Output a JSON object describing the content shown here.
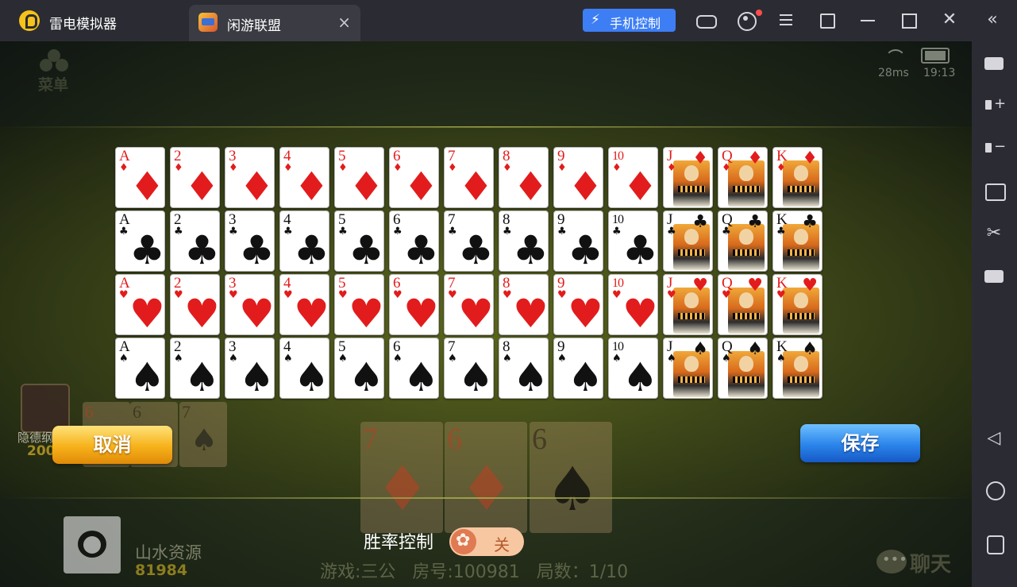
{
  "titlebar": {
    "app_name": "雷电模拟器",
    "tab_title": "闲游联盟",
    "tab_close": "×",
    "phone_control": "手机控制"
  },
  "game": {
    "menu_label": "菜单",
    "ping": "28ms",
    "clock": "19:13",
    "cancel_label": "取消",
    "save_label": "保存",
    "win_rate_label": "胜率控制",
    "win_rate_state": "关",
    "left_player": {
      "name": "隐德纲",
      "score": "200"
    },
    "self": {
      "name": "山水资源",
      "score": "81984"
    },
    "game_info": "游戏:三公   房号:100981   局数：1/10",
    "chat_label": "聊天"
  },
  "background_cards": {
    "left_hand": [
      "6",
      "6",
      "7"
    ],
    "center_hand": [
      "7",
      "6",
      "6"
    ]
  },
  "card_grid": {
    "ranks": [
      "A",
      "2",
      "3",
      "4",
      "5",
      "6",
      "7",
      "8",
      "9",
      "10",
      "J",
      "Q",
      "K"
    ],
    "suits": [
      {
        "symbol": "♦",
        "color": "#e21c1c"
      },
      {
        "symbol": "♣",
        "color": "#111111"
      },
      {
        "symbol": "♥",
        "color": "#e21c1c"
      },
      {
        "symbol": "♠",
        "color": "#111111"
      }
    ]
  },
  "icons": {
    "tab_close": "close-icon",
    "window": [
      "gamepad-icon",
      "account-icon",
      "menu-icon",
      "shrink-icon",
      "minimize-icon",
      "maximize-icon",
      "close-icon",
      "collapse-icon"
    ],
    "sidebar": [
      "keyboard-icon",
      "volume-up-icon",
      "volume-down-icon",
      "screenshot-icon",
      "scissors-icon",
      "more-icon",
      "back-icon",
      "home-icon",
      "recent-apps-icon"
    ]
  }
}
